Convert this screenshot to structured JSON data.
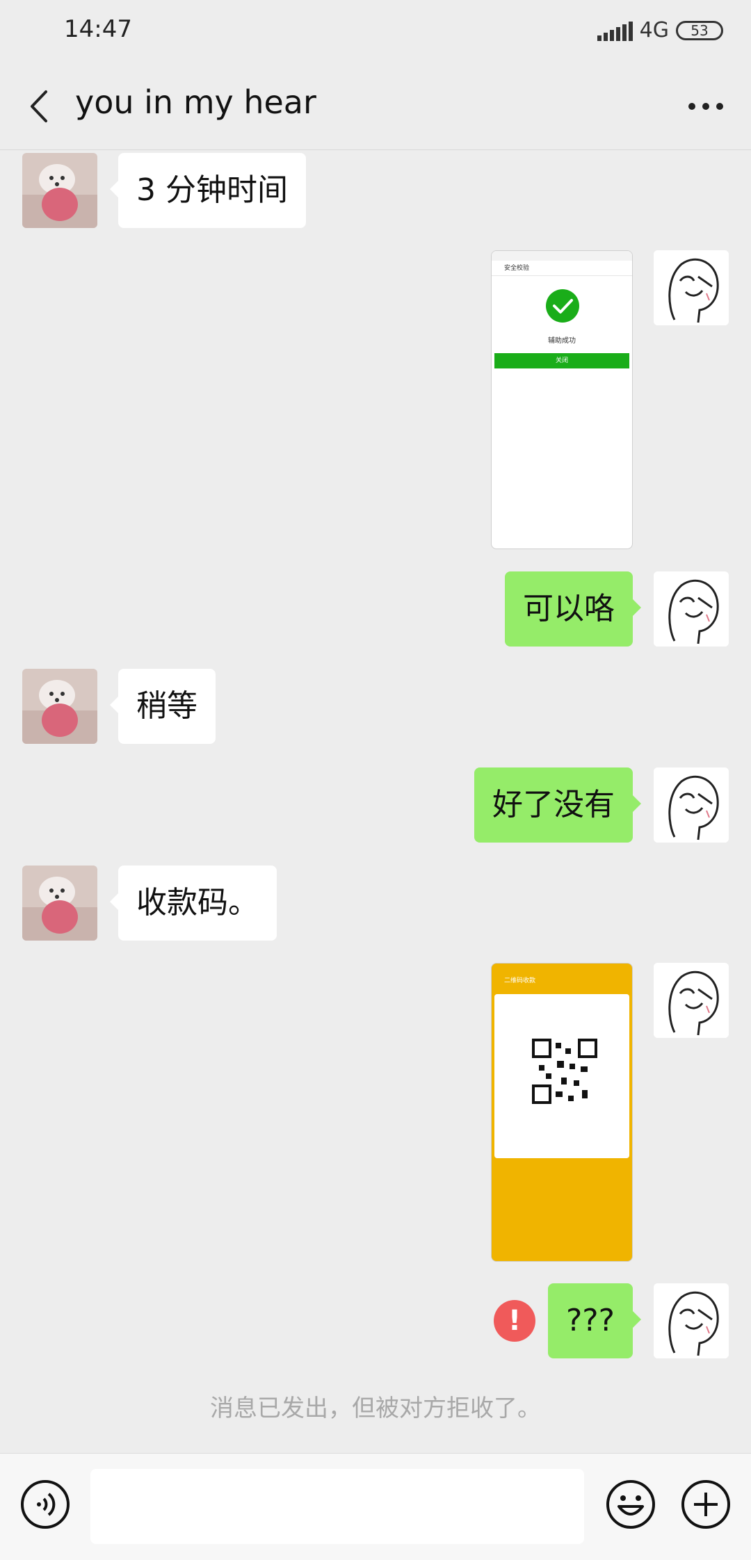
{
  "status_bar": {
    "time": "14:47",
    "network": "4G",
    "battery": "53"
  },
  "header": {
    "title": "you in my hear"
  },
  "messages": [
    {
      "text": "3 分钟时间"
    },
    {
      "text": "可以咯"
    },
    {
      "text": "稍等"
    },
    {
      "text": "好了没有"
    },
    {
      "text": "收款码。"
    },
    {
      "text": "???"
    }
  ],
  "screenshot1": {
    "title": "安全校验",
    "result": "辅助成功",
    "button": "关闭"
  },
  "screenshot2": {
    "title": "二维码收款"
  },
  "failed_indicator": "!",
  "system_note": "消息已发出，但被对方拒收了。",
  "colors": {
    "outgoing_bubble": "#95ec69",
    "incoming_bubble": "#ffffff",
    "error": "#f05a5a",
    "screenshot_yellow": "#f0b400",
    "success_green": "#1aad19"
  },
  "icons": [
    "back-arrow-icon",
    "more-icon",
    "voice-icon",
    "emoji-icon",
    "plus-icon"
  ]
}
